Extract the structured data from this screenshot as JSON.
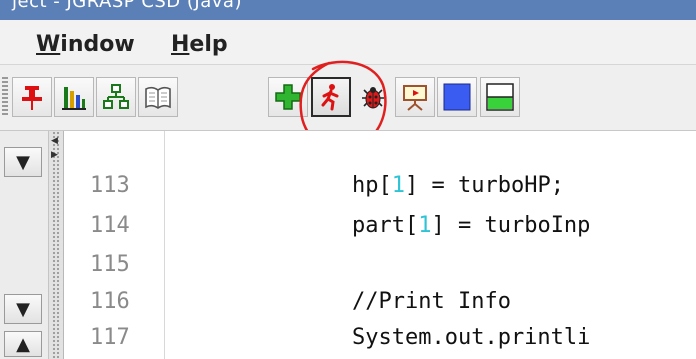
{
  "titlebar": {
    "text": "ject - JGRASP CSD (Java)"
  },
  "menu": {
    "window": {
      "mnemonic": "W",
      "rest": "indow"
    },
    "help": {
      "mnemonic": "H",
      "rest": "elp"
    }
  },
  "toolbar": {
    "buttons": [
      {
        "icon": "pushpin-icon"
      },
      {
        "icon": "bar-chart-icon"
      },
      {
        "icon": "hierarchy-icon"
      },
      {
        "icon": "open-book-icon"
      },
      {
        "icon": "green-plus-icon"
      },
      {
        "icon": "running-man-icon",
        "pressed": true
      },
      {
        "icon": "ladybug-icon"
      },
      {
        "icon": "presentation-easel-icon"
      },
      {
        "icon": "blue-square-icon"
      },
      {
        "icon": "green-window-icon"
      }
    ]
  },
  "annotation": {
    "color": "#e02020"
  },
  "editor": {
    "lines": [
      {
        "num": "113"
      },
      {
        "num": "114"
      },
      {
        "num": "115"
      },
      {
        "num": "116"
      },
      {
        "num": "117"
      }
    ],
    "code": {
      "l113_a": "hp[",
      "l113_n": "1",
      "l113_b": "] = turboHP;",
      "l114_a": "part[",
      "l114_n": "1",
      "l114_b": "] = turboInp",
      "l116": "//Print Info",
      "l117": "System.out.printli"
    }
  },
  "left_panel": {
    "dropdown_glyph": "▼",
    "scroll_up_glyph": "▲"
  }
}
